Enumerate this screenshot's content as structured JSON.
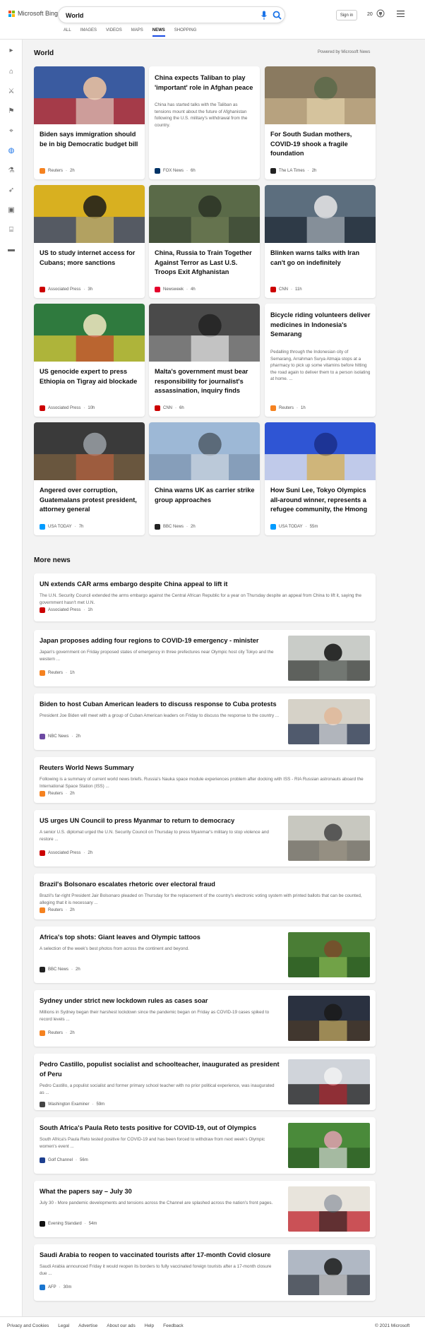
{
  "logo": {
    "text": "Microsoft Bing"
  },
  "search": {
    "value": "World"
  },
  "header": {
    "signin": "Sign in",
    "rewards_count": "20"
  },
  "tabs": [
    "ALL",
    "IMAGES",
    "VIDEOS",
    "MAPS",
    "NEWS",
    "SHOPPING"
  ],
  "rail_icons": [
    "expand-icon",
    "home-icon",
    "sports-icon",
    "flag-icon",
    "location-icon",
    "globe-icon",
    "microscope-icon",
    "rocket-icon",
    "video-icon",
    "capitol-icon",
    "card-icon"
  ],
  "world": {
    "title": "World",
    "powered_by": "Powered by Microsoft News",
    "cards": [
      {
        "title": "Biden says immigration should be in big Democratic budget bill",
        "source": "Reuters",
        "time": "2h",
        "desc": "",
        "logo_color": "#f58220"
      },
      {
        "title": "China expects Taliban to play 'important' role in Afghan peace",
        "source": "FOX News",
        "time": "6h",
        "desc": "China has started talks with the Taliban as tensions mount about the future of Afghanistan following the U.S. military's withdrawal from the country.",
        "logo_color": "#003366"
      },
      {
        "title": "For South Sudan mothers, COVID-19 shook a fragile foundation",
        "source": "The LA Times",
        "time": "2h",
        "desc": "",
        "logo_color": "#222222"
      },
      {
        "title": "US to study internet access for Cubans; more sanctions",
        "source": "Associated Press",
        "time": "3h",
        "desc": "",
        "logo_color": "#cc0000"
      },
      {
        "title": "China, Russia to Train Together Against Terror as Last U.S. Troops Exit Afghanistan",
        "source": "Newsweek",
        "time": "4h",
        "desc": "",
        "logo_color": "#e4002b"
      },
      {
        "title": "Blinken warns talks with Iran can't go on indefinitely",
        "source": "CNN",
        "time": "11h",
        "desc": "",
        "logo_color": "#cc0000"
      },
      {
        "title": "US genocide expert to press Ethiopia on Tigray aid blockade",
        "source": "Associated Press",
        "time": "10h",
        "desc": "",
        "logo_color": "#cc0000"
      },
      {
        "title": "Malta's government must bear responsibility for journalist's assassination, inquiry finds",
        "source": "CNN",
        "time": "6h",
        "desc": "",
        "logo_color": "#cc0000"
      },
      {
        "title": "Bicycle riding volunteers deliver medicines in Indonesia's Semarang",
        "source": "Reuters",
        "time": "1h",
        "desc": "Pedalling through the Indonesian city of Semarang, Arrahman Surya Atmaja stops at a pharmacy to pick up some vitamins before hitting the road again to deliver them to a person isolating at home. ...",
        "logo_color": "#f58220"
      },
      {
        "title": "Angered over corruption, Guatemalans protest president, attorney general",
        "source": "USA TODAY",
        "time": "7h",
        "desc": "",
        "logo_color": "#009bff"
      },
      {
        "title": "China warns UK as carrier strike group approaches",
        "source": "BBC News",
        "time": "2h",
        "desc": "",
        "logo_color": "#222222"
      },
      {
        "title": "How Suni Lee, Tokyo Olympics all-around winner, represents a refugee community, the Hmong",
        "source": "USA TODAY",
        "time": "55m",
        "desc": "",
        "logo_color": "#009bff"
      }
    ]
  },
  "more_news": {
    "title": "More news",
    "items": [
      {
        "title": "UN extends CAR arms embargo despite China appeal to lift it",
        "desc": "The U.N. Security Council extended the arms embargo against the Central African Republic for a year on Thursday despite an appeal from China to lift it, saying the government hasn't met U.N.",
        "source": "Associated Press",
        "time": "1h",
        "logo_color": "#cc0000"
      },
      {
        "title": "Japan proposes adding four regions to COVID-19 emergency - minister",
        "desc": "Japan's government on Friday proposed states of emergency in three prefectures near Olympic host city Tokyo and the western ...",
        "source": "Reuters",
        "time": "1h",
        "logo_color": "#f58220"
      },
      {
        "title": "Biden to host Cuban American leaders to discuss response to Cuba protests",
        "desc": "President Joe Biden will meet with a group of Cuban American leaders on Friday to discuss the response to the country ...",
        "source": "NBC News",
        "time": "2h",
        "logo_color": "#6d4aa3"
      },
      {
        "title": "Reuters World News Summary",
        "desc": "Following is a summary of current world news briefs. Russia's Nauka space module experiences problem after docking with ISS - RIA Russian astronauts aboard the International Space Station (ISS) ...",
        "source": "Reuters",
        "time": "2h",
        "logo_color": "#f58220"
      },
      {
        "title": "US urges UN Council to press Myanmar to return to democracy",
        "desc": "A senior U.S. diplomat urged the U.N. Security Council on Thursday to press Myanmar's military to stop violence and restore ...",
        "source": "Associated Press",
        "time": "2h",
        "logo_color": "#cc0000"
      },
      {
        "title": "Brazil's Bolsonaro escalates rhetoric over electoral fraud",
        "desc": "Brazil's far-right President Jair Bolsonaro pleaded on Thursday for the replacement of the country's electronic voting system with printed ballots that can be counted, alleging that it is necessary ...",
        "source": "Reuters",
        "time": "2h",
        "logo_color": "#f58220"
      },
      {
        "title": "Africa's top shots: Giant leaves and Olympic tattoos",
        "desc": "A selection of the week's best photos from across the continent and beyond.",
        "source": "BBC News",
        "time": "2h",
        "logo_color": "#222222"
      },
      {
        "title": "Sydney under strict new lockdown rules as cases soar",
        "desc": "Millions in Sydney began their harshest lockdown since the pandemic began on Friday as COVID-19 cases spiked to record levels ...",
        "source": "Reuters",
        "time": "2h",
        "logo_color": "#f58220"
      },
      {
        "title": "Pedro Castillo, populist socialist and schoolteacher, inaugurated as president of Peru",
        "desc": "Pedro Castillo, a populist socialist and former primary school teacher with no prior political experience, was inaugurated as ...",
        "source": "Washington Examiner",
        "time": "59m",
        "logo_color": "#444444"
      },
      {
        "title": "South Africa's Paula Reto tests positive for COVID-19, out of Olympics",
        "desc": "South Africa's Paula Reto tested positive for COVID-19 and has been forced to withdraw from next week's Olympic women's event ...",
        "source": "Golf Channel",
        "time": "56m",
        "logo_color": "#1d3f8f"
      },
      {
        "title": "What the papers say – July 30",
        "desc": "July 30 - More pandemic developments and tensions across the Channel are splashed across the nation's front pages.",
        "source": "Evening Standard",
        "time": "54m",
        "logo_color": "#111111"
      },
      {
        "title": "Saudi Arabia to reopen to vaccinated tourists after 17-month Covid closure",
        "desc": "Saudi Arabia announced Friday it would reopen its borders to fully vaccinated foreign tourists after a 17-month closure due ...",
        "source": "AFP",
        "time": "30m",
        "logo_color": "#1a75cf"
      }
    ]
  },
  "footer": {
    "links": [
      "Privacy and Cookies",
      "Legal",
      "Advertise",
      "About our ads",
      "Help",
      "Feedback"
    ],
    "copyright": "© 2021 Microsoft"
  }
}
